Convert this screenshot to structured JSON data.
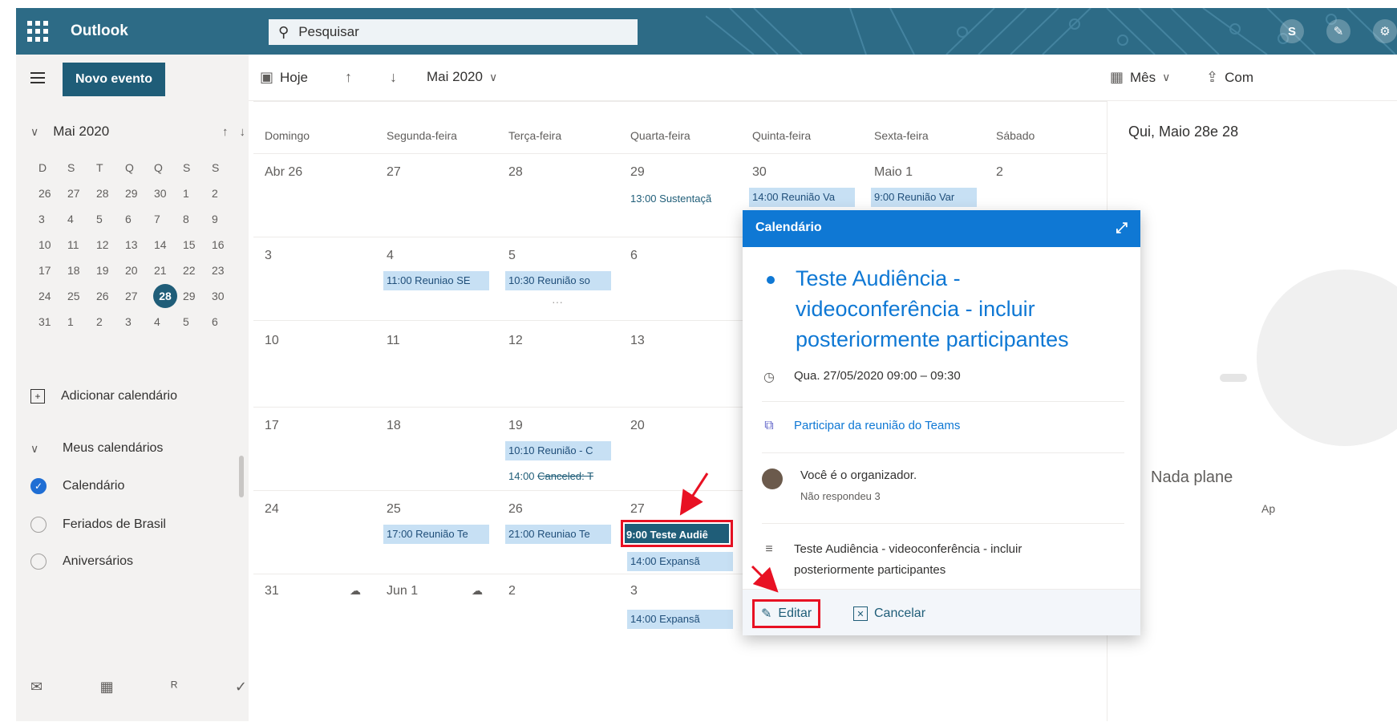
{
  "app": {
    "name": "Outlook"
  },
  "search": {
    "placeholder": "Pesquisar"
  },
  "top_icons": [
    "skype-icon",
    "feedback-icon",
    "settings-icon"
  ],
  "left": {
    "new_event": "Novo evento",
    "mini_month": "Mai 2020",
    "weekday_letters": [
      "D",
      "S",
      "T",
      "Q",
      "Q",
      "S",
      "S"
    ],
    "mini_days": [
      "26",
      "27",
      "28",
      "29",
      "30",
      "1",
      "2",
      "3",
      "4",
      "5",
      "6",
      "7",
      "8",
      "9",
      "10",
      "11",
      "12",
      "13",
      "14",
      "15",
      "16",
      "17",
      "18",
      "19",
      "20",
      "21",
      "22",
      "23",
      "24",
      "25",
      "26",
      "27",
      "28",
      "29",
      "30",
      "31",
      "1",
      "2",
      "3",
      "4",
      "5",
      "6"
    ],
    "today_index": 32,
    "add_calendar": "Adicionar calendário",
    "my_calendars": "Meus calendários",
    "calendars": [
      {
        "label": "Calendário",
        "checked": true
      },
      {
        "label": "Feriados de Brasil",
        "checked": false
      },
      {
        "label": "Aniversários",
        "checked": false
      }
    ]
  },
  "toolbar": {
    "today": "Hoje",
    "month_label": "Mai 2020",
    "view": "Mês",
    "share": "Com"
  },
  "calendar": {
    "weekdays": [
      "Domingo",
      "Segunda-feira",
      "Terça-feira",
      "Quarta-feira",
      "Quinta-feira",
      "Sexta-feira",
      "Sábado"
    ],
    "weeks": [
      [
        "Abr 26",
        "27",
        "28",
        "29",
        "30",
        "Maio 1",
        "2"
      ],
      [
        "3",
        "4",
        "5",
        "6",
        "",
        "",
        ""
      ],
      [
        "10",
        "11",
        "12",
        "13",
        "",
        "",
        ""
      ],
      [
        "17",
        "18",
        "19",
        "20",
        "",
        "",
        ""
      ],
      [
        "24",
        "25",
        "26",
        "27",
        "",
        "",
        ""
      ],
      [
        "31",
        "Jun 1",
        "2",
        "3",
        "",
        "",
        ""
      ]
    ],
    "events": {
      "e_29": "13:00 Sustentaçã",
      "e_30": "14:00 Reunião Va",
      "e_may1": "9:00 Reunião Var",
      "e_4": "11:00 Reuniao SE",
      "e_5": "10:30 Reunião so",
      "more": "···",
      "e_19a": "10:10 Reunião - C",
      "e_19b_time": "14:00 ",
      "e_19b_title": "Canceled: T",
      "e_25": "17:00 Reunião Te",
      "e_26": "21:00 Reuniao Te",
      "e_27_sel": "9:00 Teste Audiê",
      "e_27b": "14:00 Expansã",
      "e_jun3": "14:00 Expansã"
    }
  },
  "right": {
    "title": "Qui, Maio 28e 28",
    "empty": "Nada plane",
    "empty_sub": "Ap"
  },
  "card": {
    "header": "Calendário",
    "title": "Teste Audiência - videoconferência - incluir posteriormente participantes",
    "time": "Qua. 27/05/2020 09:00 – 09:30",
    "teams_link": "Participar da reunião do Teams",
    "organizer": "Você é o organizador.",
    "responses": "Não respondeu 3",
    "description": "Teste Audiência - videoconferência - incluir posteriormente participantes",
    "edit": "Editar",
    "cancel": "Cancelar"
  }
}
